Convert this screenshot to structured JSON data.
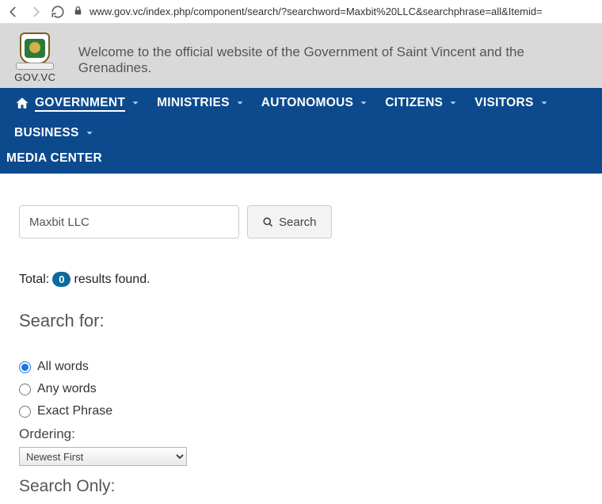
{
  "browser": {
    "url": "www.gov.vc/index.php/component/search/?searchword=Maxbit%20LLC&searchphrase=all&Itemid="
  },
  "header": {
    "site_name": "GOV.VC",
    "welcome": "Welcome to the official website of the Government of Saint Vincent and the Grenadines."
  },
  "nav": {
    "items": [
      "GOVERNMENT",
      "MINISTRIES",
      "AUTONOMOUS",
      "CITIZENS",
      "VISITORS",
      "BUSINESS"
    ],
    "media": "MEDIA CENTER"
  },
  "search": {
    "value": "Maxbit LLC",
    "button": "Search",
    "total_prefix": "Total:",
    "total_count": "0",
    "total_suffix": "results found.",
    "search_for": "Search for:",
    "options": {
      "all": "All words",
      "any": "Any words",
      "exact": "Exact Phrase"
    },
    "ordering_label": "Ordering:",
    "ordering_value": "Newest First",
    "search_only": "Search Only:"
  }
}
